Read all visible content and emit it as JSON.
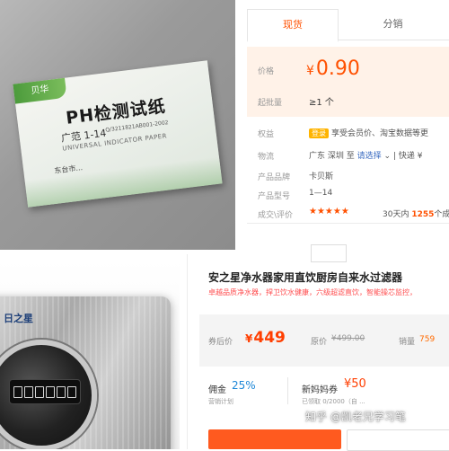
{
  "product1": {
    "box": {
      "logo": "贝华",
      "title": "PH检测试纸",
      "range": "广范 1-14",
      "standard": "Q/3211821AB001-2002",
      "subtitle": "UNIVERSAL INDICATOR PAPER",
      "maker": "东台市..."
    },
    "tabs": [
      "现货",
      "分销"
    ],
    "price_label": "价格",
    "currency": "¥",
    "price": "0.90",
    "batch_label": "起批量",
    "batch_value": "≥1 个",
    "rights_label": "权益",
    "rights_badge": "登录",
    "rights_text": "享受会员价、淘宝数据等更",
    "logistics_label": "物流",
    "logistics_from": "广东 深圳",
    "logistics_to": "至",
    "logistics_select": "请选择",
    "logistics_sep": "|",
    "logistics_speed": "快递 ¥",
    "brand_label": "产品品牌",
    "brand_value": "卡贝斯",
    "model_label": "产品型号",
    "model_value": "1—14",
    "deals_label": "成交\\评价",
    "stars": "★★★★★",
    "sales_prefix": "30天内",
    "sales_count": "1255",
    "sales_suffix": "个成"
  },
  "product2": {
    "image_brand": "日之星",
    "title": "安之星净水器家用直饮厨房自来水过滤器",
    "subtitle": "卓越品质净水器，捍卫饮水健康，六级超滤直饮，智能操芯监控，",
    "after_coupon_label": "券后价",
    "currency": "¥",
    "price": "449",
    "orig_label": "原价",
    "orig_price": "¥499.00",
    "sold_label": "销量",
    "sold_value": "759",
    "commission_label": "佣金",
    "commission_value": "25%",
    "commission_plan": "营销计划",
    "coupon_label": "新妈妈券",
    "coupon_value": "¥50",
    "coupon_claimed": "已领取 0/2000（自 ..."
  },
  "watermark": "知乎 @凯老兄学习笔",
  "colors": {
    "accent": "#ff5000",
    "price_red": "#ff3e00",
    "link_blue": "#3a6bc1",
    "commission_blue": "#1e88d8",
    "price_bg": "#fff2e8"
  }
}
